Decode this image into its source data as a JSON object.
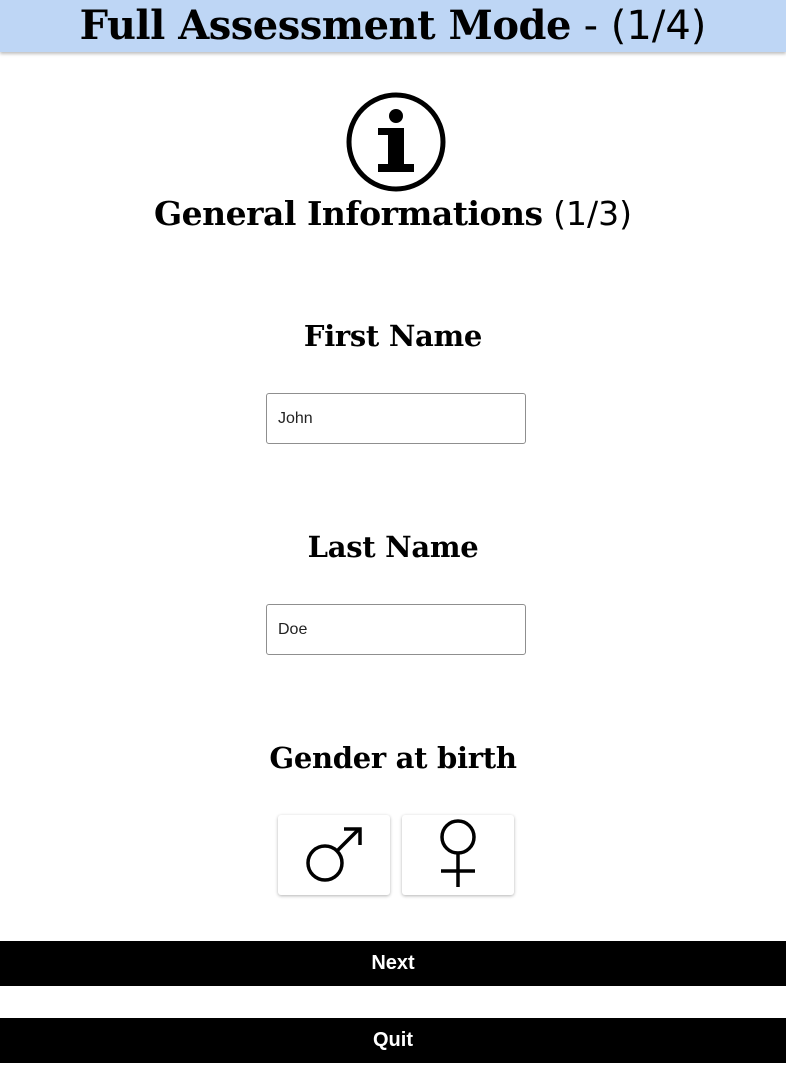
{
  "header": {
    "title_bold": "Full Assessment Mode",
    "title_rest": " - (1/4)"
  },
  "section": {
    "icon": "info-circle-icon",
    "title_bold": "General Informations",
    "title_rest": " (1/3)"
  },
  "form": {
    "first_name_label": "First Name",
    "first_name_value": "John",
    "last_name_label": "Last Name",
    "last_name_value": "Doe",
    "gender_label": "Gender at birth",
    "gender_options": [
      {
        "icon": "male-symbol-icon"
      },
      {
        "icon": "female-symbol-icon"
      }
    ]
  },
  "actions": {
    "next_label": "Next",
    "quit_label": "Quit"
  },
  "colors": {
    "header_bg": "#bed6f5",
    "button_bg": "#000000",
    "button_text": "#ffffff"
  }
}
